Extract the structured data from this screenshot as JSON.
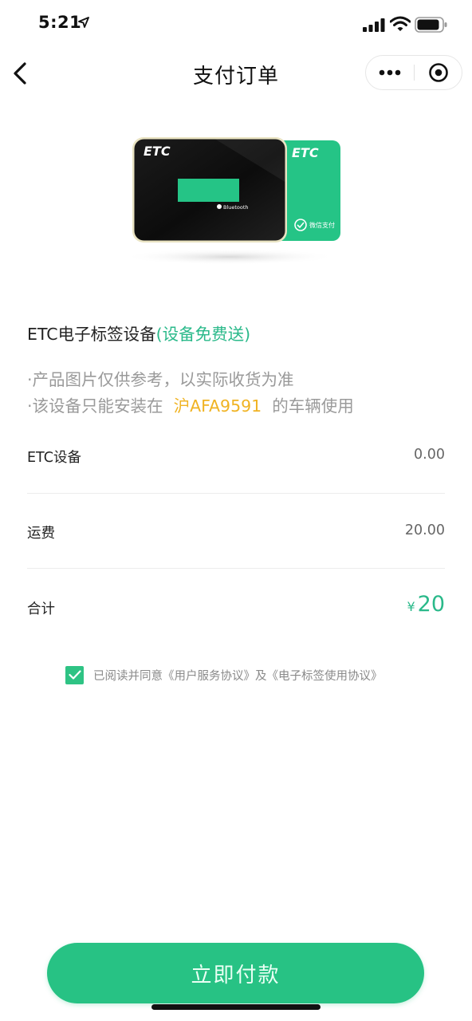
{
  "status_bar": {
    "time": "5:21",
    "icons": [
      "location-arrow-icon",
      "signal-icon",
      "wifi-icon",
      "battery-icon"
    ]
  },
  "nav": {
    "title": "支付订单",
    "back_icon": "chevron-left-icon",
    "more_icon": "more-dots-icon",
    "close_icon": "target-close-icon"
  },
  "product_image": {
    "device_logo": "ETC",
    "card_logo": "ETC",
    "device_label": "Bluetooth",
    "card_label": "微信支付"
  },
  "product": {
    "name": "ETC电子标签设备",
    "free_tag": "(设备免费送)"
  },
  "notes": {
    "line1": "·产品图片仅供参考，以实际收货为准",
    "line2_prefix": "·该设备只能安装在",
    "plate": "沪AFA9591",
    "line2_suffix": "的车辆使用"
  },
  "rows": [
    {
      "label": "ETC设备",
      "value": "0.00"
    },
    {
      "label": "运费",
      "value": "20.00"
    }
  ],
  "total": {
    "label": "合计",
    "currency": "¥",
    "amount": "20"
  },
  "agreement": {
    "checked": true,
    "text": "已阅读并同意《用户服务协议》及《电子标签使用协议》"
  },
  "pay_button": {
    "label": "立即付款"
  },
  "colors": {
    "accent": "#27c284",
    "plate": "#f0b323",
    "muted": "#9a9a9a"
  }
}
